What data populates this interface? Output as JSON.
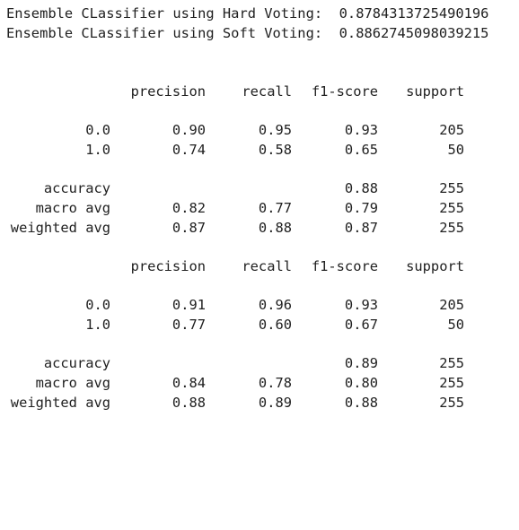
{
  "scores": [
    {
      "label": "Ensemble CLassifier using Hard Voting:",
      "value": "0.8784313725490196"
    },
    {
      "label": "Ensemble CLassifier using Soft Voting:",
      "value": "0.8862745098039215"
    }
  ],
  "reports": [
    {
      "header": [
        "precision",
        "recall",
        "f1-score",
        "support"
      ],
      "class_rows": [
        {
          "label": "0.0",
          "precision": "0.90",
          "recall": "0.95",
          "f1": "0.93",
          "support": "205"
        },
        {
          "label": "1.0",
          "precision": "0.74",
          "recall": "0.58",
          "f1": "0.65",
          "support": "50"
        }
      ],
      "summary_rows": [
        {
          "label": "accuracy",
          "precision": "",
          "recall": "",
          "f1": "0.88",
          "support": "255"
        },
        {
          "label": "macro avg",
          "precision": "0.82",
          "recall": "0.77",
          "f1": "0.79",
          "support": "255"
        },
        {
          "label": "weighted avg",
          "precision": "0.87",
          "recall": "0.88",
          "f1": "0.87",
          "support": "255"
        }
      ]
    },
    {
      "header": [
        "precision",
        "recall",
        "f1-score",
        "support"
      ],
      "class_rows": [
        {
          "label": "0.0",
          "precision": "0.91",
          "recall": "0.96",
          "f1": "0.93",
          "support": "205"
        },
        {
          "label": "1.0",
          "precision": "0.77",
          "recall": "0.60",
          "f1": "0.67",
          "support": "50"
        }
      ],
      "summary_rows": [
        {
          "label": "accuracy",
          "precision": "",
          "recall": "",
          "f1": "0.89",
          "support": "255"
        },
        {
          "label": "macro avg",
          "precision": "0.84",
          "recall": "0.78",
          "f1": "0.80",
          "support": "255"
        },
        {
          "label": "weighted avg",
          "precision": "0.88",
          "recall": "0.89",
          "f1": "0.88",
          "support": "255"
        }
      ]
    }
  ]
}
